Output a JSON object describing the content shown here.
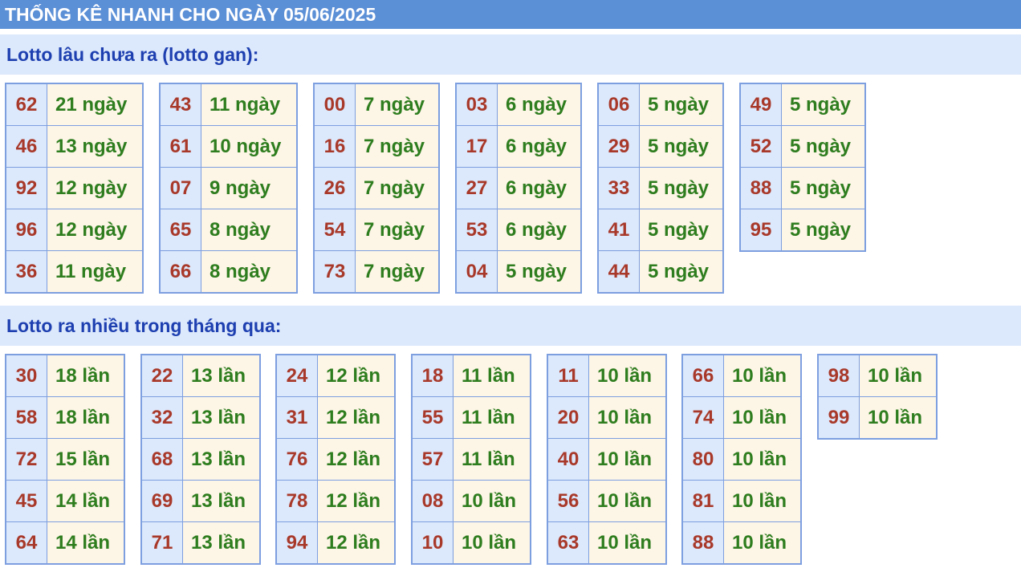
{
  "header": {
    "title": "THỐNG KÊ NHANH CHO NGÀY 05/06/2025"
  },
  "gan": {
    "title": "Lotto lâu chưa ra (lotto gan):",
    "groups": [
      {
        "rows": [
          {
            "num": "62",
            "val": "21 ngày"
          },
          {
            "num": "46",
            "val": "13 ngày"
          },
          {
            "num": "92",
            "val": "12 ngày"
          },
          {
            "num": "96",
            "val": "12 ngày"
          },
          {
            "num": "36",
            "val": "11 ngày"
          }
        ]
      },
      {
        "rows": [
          {
            "num": "43",
            "val": "11 ngày"
          },
          {
            "num": "61",
            "val": "10 ngày"
          },
          {
            "num": "07",
            "val": "9 ngày"
          },
          {
            "num": "65",
            "val": "8 ngày"
          },
          {
            "num": "66",
            "val": "8 ngày"
          }
        ]
      },
      {
        "rows": [
          {
            "num": "00",
            "val": "7 ngày"
          },
          {
            "num": "16",
            "val": "7 ngày"
          },
          {
            "num": "26",
            "val": "7 ngày"
          },
          {
            "num": "54",
            "val": "7 ngày"
          },
          {
            "num": "73",
            "val": "7 ngày"
          }
        ]
      },
      {
        "rows": [
          {
            "num": "03",
            "val": "6 ngày"
          },
          {
            "num": "17",
            "val": "6 ngày"
          },
          {
            "num": "27",
            "val": "6 ngày"
          },
          {
            "num": "53",
            "val": "6 ngày"
          },
          {
            "num": "04",
            "val": "5 ngày"
          }
        ]
      },
      {
        "rows": [
          {
            "num": "06",
            "val": "5 ngày"
          },
          {
            "num": "29",
            "val": "5 ngày"
          },
          {
            "num": "33",
            "val": "5 ngày"
          },
          {
            "num": "41",
            "val": "5 ngày"
          },
          {
            "num": "44",
            "val": "5 ngày"
          }
        ]
      },
      {
        "rows": [
          {
            "num": "49",
            "val": "5 ngày"
          },
          {
            "num": "52",
            "val": "5 ngày"
          },
          {
            "num": "88",
            "val": "5 ngày"
          },
          {
            "num": "95",
            "val": "5 ngày"
          }
        ]
      }
    ]
  },
  "nhieu": {
    "title": "Lotto ra nhiều trong tháng qua:",
    "groups": [
      {
        "rows": [
          {
            "num": "30",
            "val": "18 lần"
          },
          {
            "num": "58",
            "val": "18 lần"
          },
          {
            "num": "72",
            "val": "15 lần"
          },
          {
            "num": "45",
            "val": "14 lần"
          },
          {
            "num": "64",
            "val": "14 lần"
          }
        ]
      },
      {
        "rows": [
          {
            "num": "22",
            "val": "13 lần"
          },
          {
            "num": "32",
            "val": "13 lần"
          },
          {
            "num": "68",
            "val": "13 lần"
          },
          {
            "num": "69",
            "val": "13 lần"
          },
          {
            "num": "71",
            "val": "13 lần"
          }
        ]
      },
      {
        "rows": [
          {
            "num": "24",
            "val": "12 lần"
          },
          {
            "num": "31",
            "val": "12 lần"
          },
          {
            "num": "76",
            "val": "12 lần"
          },
          {
            "num": "78",
            "val": "12 lần"
          },
          {
            "num": "94",
            "val": "12 lần"
          }
        ]
      },
      {
        "rows": [
          {
            "num": "18",
            "val": "11 lần"
          },
          {
            "num": "55",
            "val": "11 lần"
          },
          {
            "num": "57",
            "val": "11 lần"
          },
          {
            "num": "08",
            "val": "10 lần"
          },
          {
            "num": "10",
            "val": "10 lần"
          }
        ]
      },
      {
        "rows": [
          {
            "num": "11",
            "val": "10 lần"
          },
          {
            "num": "20",
            "val": "10 lần"
          },
          {
            "num": "40",
            "val": "10 lần"
          },
          {
            "num": "56",
            "val": "10 lần"
          },
          {
            "num": "63",
            "val": "10 lần"
          }
        ]
      },
      {
        "rows": [
          {
            "num": "66",
            "val": "10 lần"
          },
          {
            "num": "74",
            "val": "10 lần"
          },
          {
            "num": "80",
            "val": "10 lần"
          },
          {
            "num": "81",
            "val": "10 lần"
          },
          {
            "num": "88",
            "val": "10 lần"
          }
        ]
      },
      {
        "rows": [
          {
            "num": "98",
            "val": "10 lần"
          },
          {
            "num": "99",
            "val": "10 lần"
          }
        ]
      }
    ]
  }
}
